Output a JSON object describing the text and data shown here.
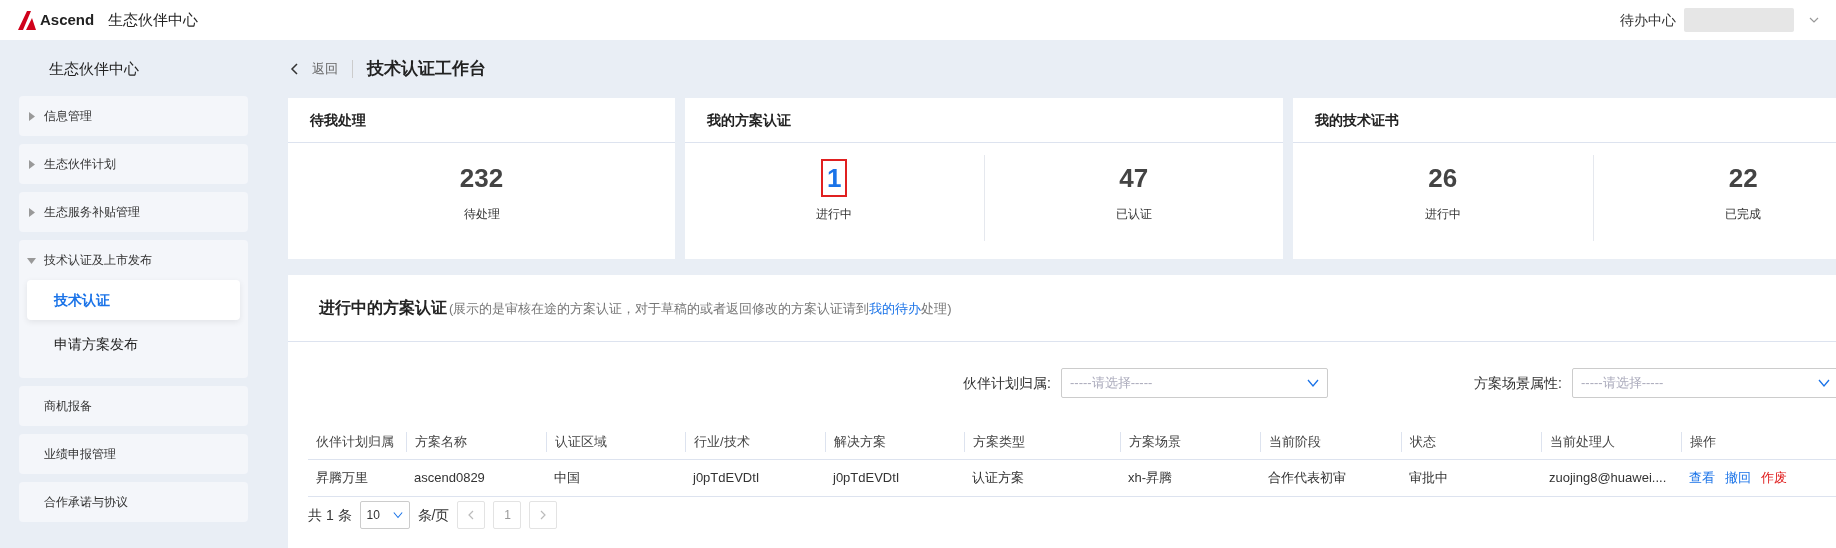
{
  "header": {
    "logo_text": "Ascend",
    "app_title": "生态伙伴中心",
    "todo_link": "待办中心"
  },
  "sidebar": {
    "title": "生态伙伴中心",
    "items": [
      {
        "kind": "group",
        "label": "信息管理",
        "expanded": false
      },
      {
        "kind": "group",
        "label": "生态伙伴计划",
        "expanded": false
      },
      {
        "kind": "group",
        "label": "生态服务补贴管理",
        "expanded": false
      },
      {
        "kind": "group",
        "label": "技术认证及上市发布",
        "expanded": true,
        "children": [
          {
            "label": "技术认证",
            "selected": true
          },
          {
            "label": "申请方案发布",
            "selected": false
          }
        ]
      },
      {
        "kind": "item",
        "label": "商机报备"
      },
      {
        "kind": "item",
        "label": "业绩申报管理"
      },
      {
        "kind": "item",
        "label": "合作承诺与协议"
      }
    ]
  },
  "page": {
    "back": "返回",
    "title": "技术认证工作台"
  },
  "cards": [
    {
      "title": "待我处理",
      "stats": [
        {
          "value": "232",
          "label": "待处理",
          "link": false,
          "highlighted": false
        }
      ]
    },
    {
      "title": "我的方案认证",
      "stats": [
        {
          "value": "1",
          "label": "进行中",
          "link": true,
          "highlighted": true
        },
        {
          "value": "47",
          "label": "已认证",
          "link": false,
          "highlighted": false
        }
      ]
    },
    {
      "title": "我的技术证书",
      "stats": [
        {
          "value": "26",
          "label": "进行中",
          "link": false,
          "highlighted": false
        },
        {
          "value": "22",
          "label": "已完成",
          "link": false,
          "highlighted": false
        }
      ]
    }
  ],
  "section": {
    "title": "进行中的方案认证",
    "note_before": "(展示的是审核在途的方案认证，对于草稿的或者返回修改的方案认证请到",
    "note_link": "我的待办",
    "note_after": "处理)"
  },
  "filters": [
    {
      "label": "伙伴计划归属:",
      "placeholder": "-----请选择-----"
    },
    {
      "label": "方案场景属性:",
      "placeholder": "-----请选择-----"
    }
  ],
  "table": {
    "columns": [
      "伙伴计划归属",
      "方案名称",
      "认证区域",
      "行业/技术",
      "解决方案",
      "方案类型",
      "方案场景",
      "当前阶段",
      "状态",
      "当前处理人",
      "操作"
    ],
    "rows": [
      {
        "cells": [
          "昇腾万里",
          "ascend0829",
          "中国",
          "j0pTdEVDtI",
          "j0pTdEVDtI",
          "认证方案",
          "xh-昇腾",
          "合作代表初审",
          "审批中",
          "zuojing8@huawei...."
        ],
        "actions": [
          {
            "label": "查看",
            "kind": "normal"
          },
          {
            "label": "撤回",
            "kind": "normal"
          },
          {
            "label": "作废",
            "kind": "danger"
          }
        ]
      }
    ]
  },
  "pagination": {
    "total": "共 1 条",
    "page_size": "10",
    "per_page": "条/页",
    "pages": [
      "1"
    ]
  }
}
